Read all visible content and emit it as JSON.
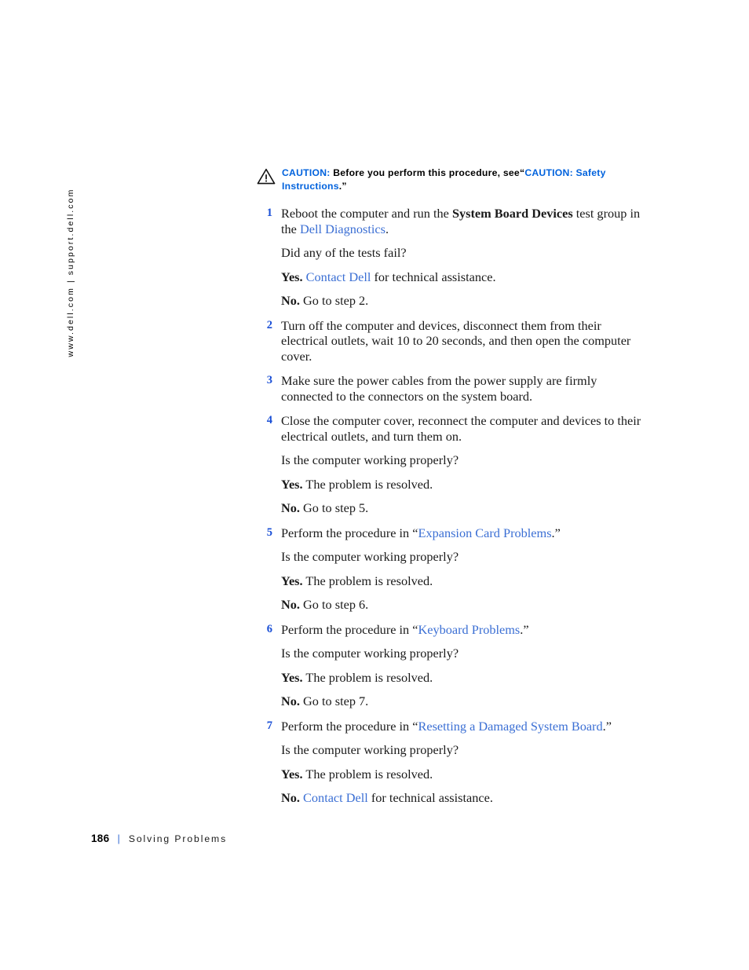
{
  "side_rail": {
    "text": "www.dell.com | support.dell.com"
  },
  "caution": {
    "icon": "warning-triangle-icon",
    "label": "CAUTION:",
    "body_before": "Before you perform this procedure, see",
    "quote_open": "“",
    "link": "CAUTION: Safety Instructions",
    "quote_close": ".”"
  },
  "colors": {
    "caution_blue": "#0062dd",
    "link_blue": "#3b6fd4",
    "step_number_blue": "#1a4fd6",
    "text_black": "#1a1a1a",
    "page_background": "#ffffff"
  },
  "steps": [
    {
      "number": "1",
      "parts": [
        {
          "text": "Reboot the computer and run the ",
          "style": "normal"
        },
        {
          "text": "System Board Devices",
          "style": "bold"
        },
        {
          "text": " test group in the ",
          "style": "normal"
        },
        {
          "text": "Dell Diagnostics",
          "style": "link"
        },
        {
          "text": ".",
          "style": "normal"
        }
      ],
      "subs": [
        [
          {
            "text": "Did any of the tests fail?",
            "style": "normal"
          }
        ],
        [
          {
            "text": "Yes.",
            "style": "bold"
          },
          {
            "text": " ",
            "style": "normal"
          },
          {
            "text": "Contact Dell",
            "style": "link"
          },
          {
            "text": " for technical assistance.",
            "style": "normal"
          }
        ],
        [
          {
            "text": "No.",
            "style": "bold"
          },
          {
            "text": " Go to step 2.",
            "style": "normal"
          }
        ]
      ]
    },
    {
      "number": "2",
      "parts": [
        {
          "text": "Turn off the computer and devices, disconnect them from their electrical outlets, wait 10 to 20 seconds, and then open the computer cover.",
          "style": "normal"
        }
      ],
      "subs": []
    },
    {
      "number": "3",
      "parts": [
        {
          "text": "Make sure the power cables from the power supply are firmly connected to the connectors on the system board.",
          "style": "normal"
        }
      ],
      "subs": []
    },
    {
      "number": "4",
      "parts": [
        {
          "text": "Close the computer cover, reconnect the computer and devices to their electrical outlets, and turn them on.",
          "style": "normal"
        }
      ],
      "subs": [
        [
          {
            "text": "Is the computer working properly?",
            "style": "normal"
          }
        ],
        [
          {
            "text": "Yes.",
            "style": "bold"
          },
          {
            "text": " The problem is resolved.",
            "style": "normal"
          }
        ],
        [
          {
            "text": "No.",
            "style": "bold"
          },
          {
            "text": " Go to step 5.",
            "style": "normal"
          }
        ]
      ]
    },
    {
      "number": "5",
      "parts": [
        {
          "text": "Perform the procedure in “",
          "style": "normal"
        },
        {
          "text": "Expansion Card Problems",
          "style": "link"
        },
        {
          "text": ".”",
          "style": "normal"
        }
      ],
      "subs": [
        [
          {
            "text": "Is the computer working properly?",
            "style": "normal"
          }
        ],
        [
          {
            "text": "Yes.",
            "style": "bold"
          },
          {
            "text": " The problem is resolved.",
            "style": "normal"
          }
        ],
        [
          {
            "text": "No.",
            "style": "bold"
          },
          {
            "text": " Go to step 6.",
            "style": "normal"
          }
        ]
      ]
    },
    {
      "number": "6",
      "parts": [
        {
          "text": "Perform the procedure in “",
          "style": "normal"
        },
        {
          "text": "Keyboard Problems",
          "style": "link"
        },
        {
          "text": ".”",
          "style": "normal"
        }
      ],
      "subs": [
        [
          {
            "text": "Is the computer working properly?",
            "style": "normal"
          }
        ],
        [
          {
            "text": "Yes.",
            "style": "bold"
          },
          {
            "text": " The problem is resolved.",
            "style": "normal"
          }
        ],
        [
          {
            "text": "No.",
            "style": "bold"
          },
          {
            "text": " Go to step 7.",
            "style": "normal"
          }
        ]
      ]
    },
    {
      "number": "7",
      "parts": [
        {
          "text": "Perform the procedure in “",
          "style": "normal"
        },
        {
          "text": "Resetting a Damaged System Board",
          "style": "link"
        },
        {
          "text": ".”",
          "style": "normal"
        }
      ],
      "subs": [
        [
          {
            "text": "Is the computer working properly?",
            "style": "normal"
          }
        ],
        [
          {
            "text": "Yes.",
            "style": "bold"
          },
          {
            "text": " The problem is resolved.",
            "style": "normal"
          }
        ],
        [
          {
            "text": "No.",
            "style": "bold"
          },
          {
            "text": " ",
            "style": "normal"
          },
          {
            "text": "Contact Dell",
            "style": "link"
          },
          {
            "text": " for technical assistance.",
            "style": "normal"
          }
        ]
      ]
    }
  ],
  "footer": {
    "page_number": "186",
    "separator": "|",
    "section_title": "Solving Problems"
  }
}
